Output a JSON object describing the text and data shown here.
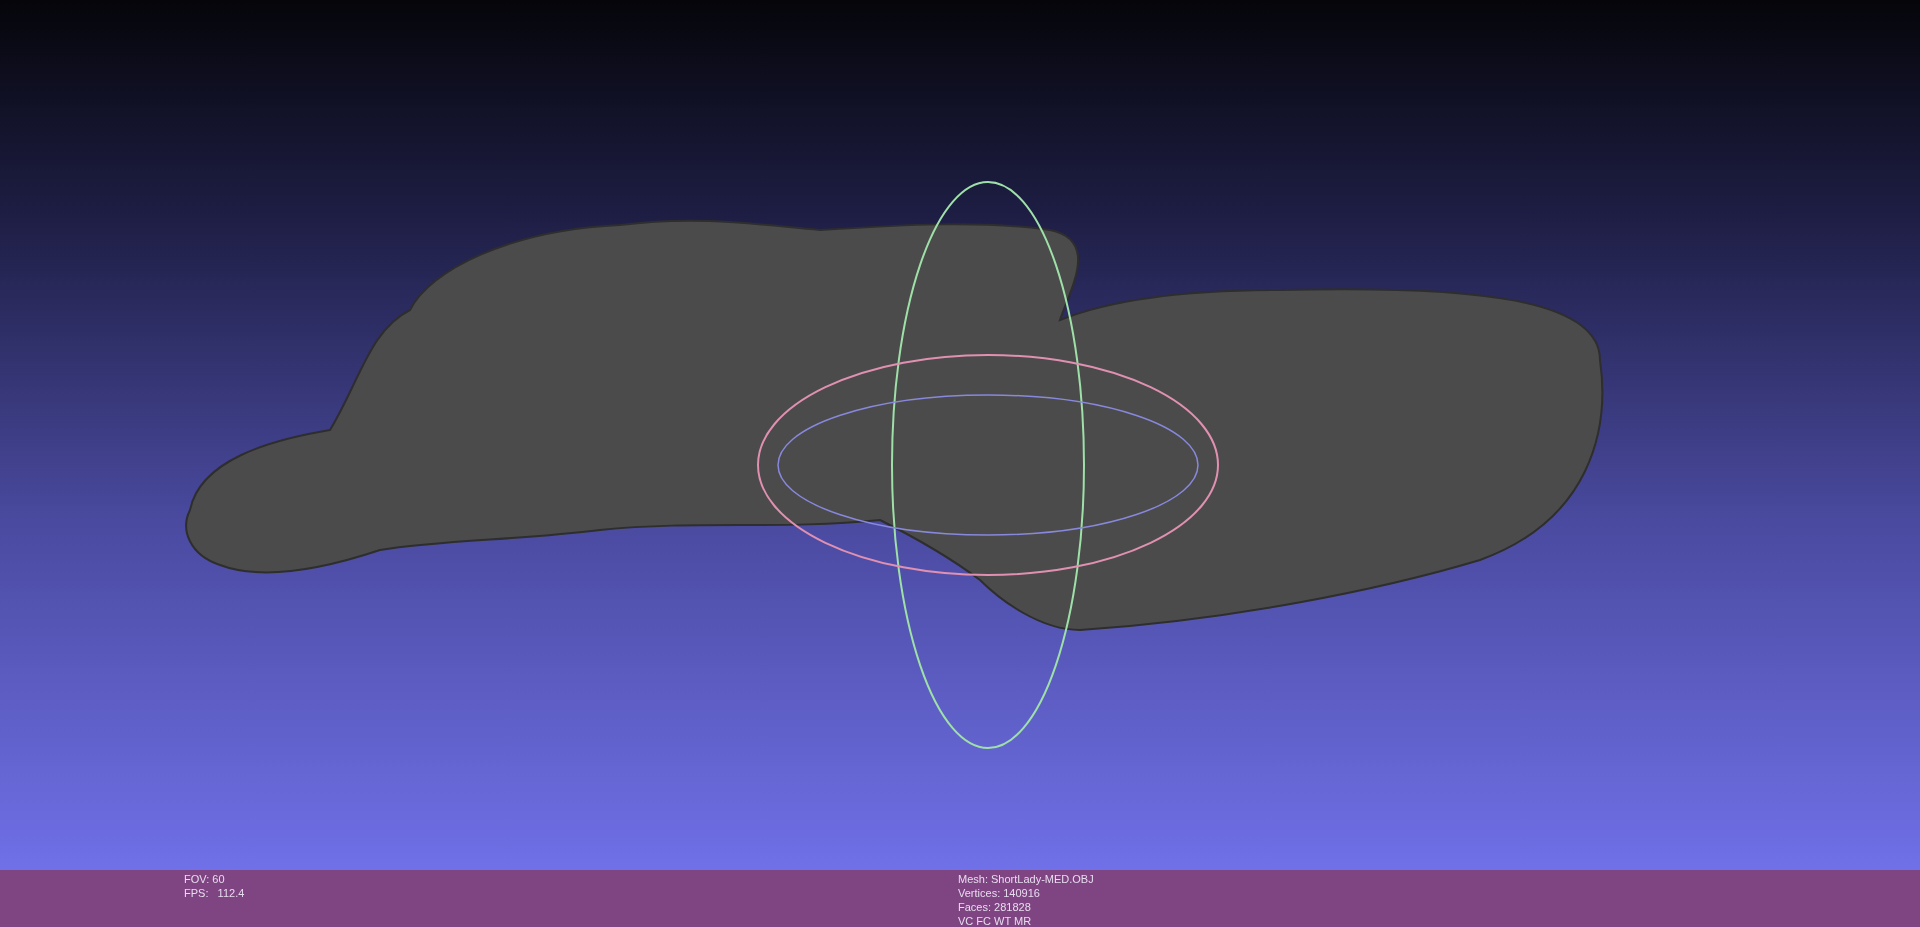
{
  "status_bar": {
    "left": [
      "FOV: 60",
      "FPS:   112.4"
    ],
    "info": [
      "Mesh: ShortLady-MED.OBJ",
      "Vertices: 140916",
      "Faces: 281828",
      "VC FC WT MR"
    ]
  }
}
